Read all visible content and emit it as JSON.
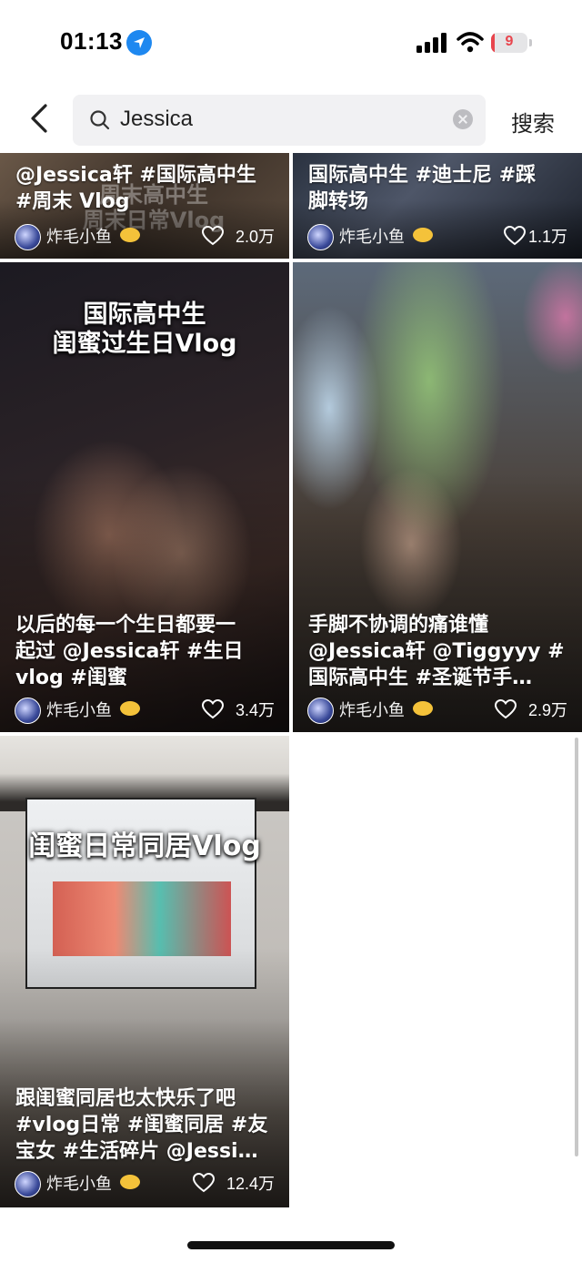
{
  "status_bar": {
    "time": "01:13",
    "battery": "9",
    "battery_color": "#e8454d"
  },
  "search": {
    "query": "Jessica",
    "button": "搜索"
  },
  "cards": [
    {
      "title_lines": [
        "@Jessica轩 #国际高中生",
        "#周末 Vlog"
      ],
      "overlay_text": "周末高中生\n周末日常Vlog",
      "author": "炸毛小鱼",
      "likes": "2.0万"
    },
    {
      "title_lines": [
        "国际高中生 #迪士尼 #踩",
        "脚转场"
      ],
      "author": "炸毛小鱼",
      "likes": "1.1万"
    },
    {
      "overlay_lines": [
        "国际高中生",
        "闺蜜过生日Vlog"
      ],
      "title_lines": [
        "以后的每一个生日都要一",
        "起过 @Jessica轩 #生日",
        "vlog #闺蜜"
      ],
      "author": "炸毛小鱼",
      "likes": "3.4万"
    },
    {
      "title_lines": [
        "手脚不协调的痛谁懂",
        "@Jessica轩 @Tiggyyy #",
        "国际高中生 #圣诞节手…"
      ],
      "author": "炸毛小鱼",
      "likes": "2.9万"
    },
    {
      "overlay_lines": [
        "闺蜜日常同居Vlog"
      ],
      "title_lines": [
        "跟闺蜜同居也太快乐了吧",
        "#vlog日常 #闺蜜同居 #友",
        "宝女 #生活碎片 @Jessi…"
      ],
      "author": "炸毛小鱼",
      "likes": "12.4万"
    }
  ]
}
